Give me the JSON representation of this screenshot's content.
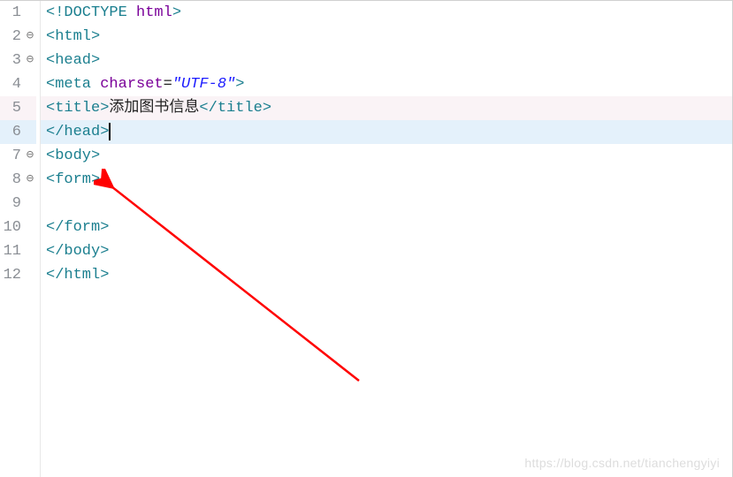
{
  "gutter": {
    "lines": [
      {
        "n": "1",
        "fold": false
      },
      {
        "n": "2",
        "fold": true
      },
      {
        "n": "3",
        "fold": true
      },
      {
        "n": "4",
        "fold": false
      },
      {
        "n": "5",
        "fold": false
      },
      {
        "n": "6",
        "fold": false
      },
      {
        "n": "7",
        "fold": true
      },
      {
        "n": "8",
        "fold": true
      },
      {
        "n": "9",
        "fold": false
      },
      {
        "n": "10",
        "fold": false
      },
      {
        "n": "11",
        "fold": false
      },
      {
        "n": "12",
        "fold": false
      }
    ],
    "fold_icon": "⊖"
  },
  "code": {
    "l1": {
      "doctype_open": "<!",
      "doctype": "DOCTYPE",
      "space": " ",
      "html": "html",
      "close": ">"
    },
    "l2": {
      "open": "<",
      "tag": "html",
      "close": ">"
    },
    "l3": {
      "open": "<",
      "tag": "head",
      "close": ">"
    },
    "l4": {
      "open": "<",
      "tag": "meta",
      "sp": " ",
      "attr": "charset",
      "eq": "=",
      "q1": "\"",
      "val": "UTF-8",
      "q2": "\"",
      "close": ">"
    },
    "l5": {
      "open": "<",
      "tag": "title",
      "gt": ">",
      "text": "添加图书信息",
      "open2": "</",
      "tag2": "title",
      "close": ">"
    },
    "l6": {
      "open": "</",
      "tag": "head",
      "close": ">"
    },
    "l7": {
      "open": "<",
      "tag": "body",
      "close": ">"
    },
    "l8": {
      "open": "<",
      "tag": "form",
      "close": ">"
    },
    "l9": {
      "text": ""
    },
    "l10": {
      "open": "</",
      "tag": "form",
      "close": ">"
    },
    "l11": {
      "open": "</",
      "tag": "body",
      "close": ">"
    },
    "l12": {
      "open": "</",
      "tag": "html",
      "close": ">"
    }
  },
  "watermark": "https://blog.csdn.net/tianchengyiyi"
}
